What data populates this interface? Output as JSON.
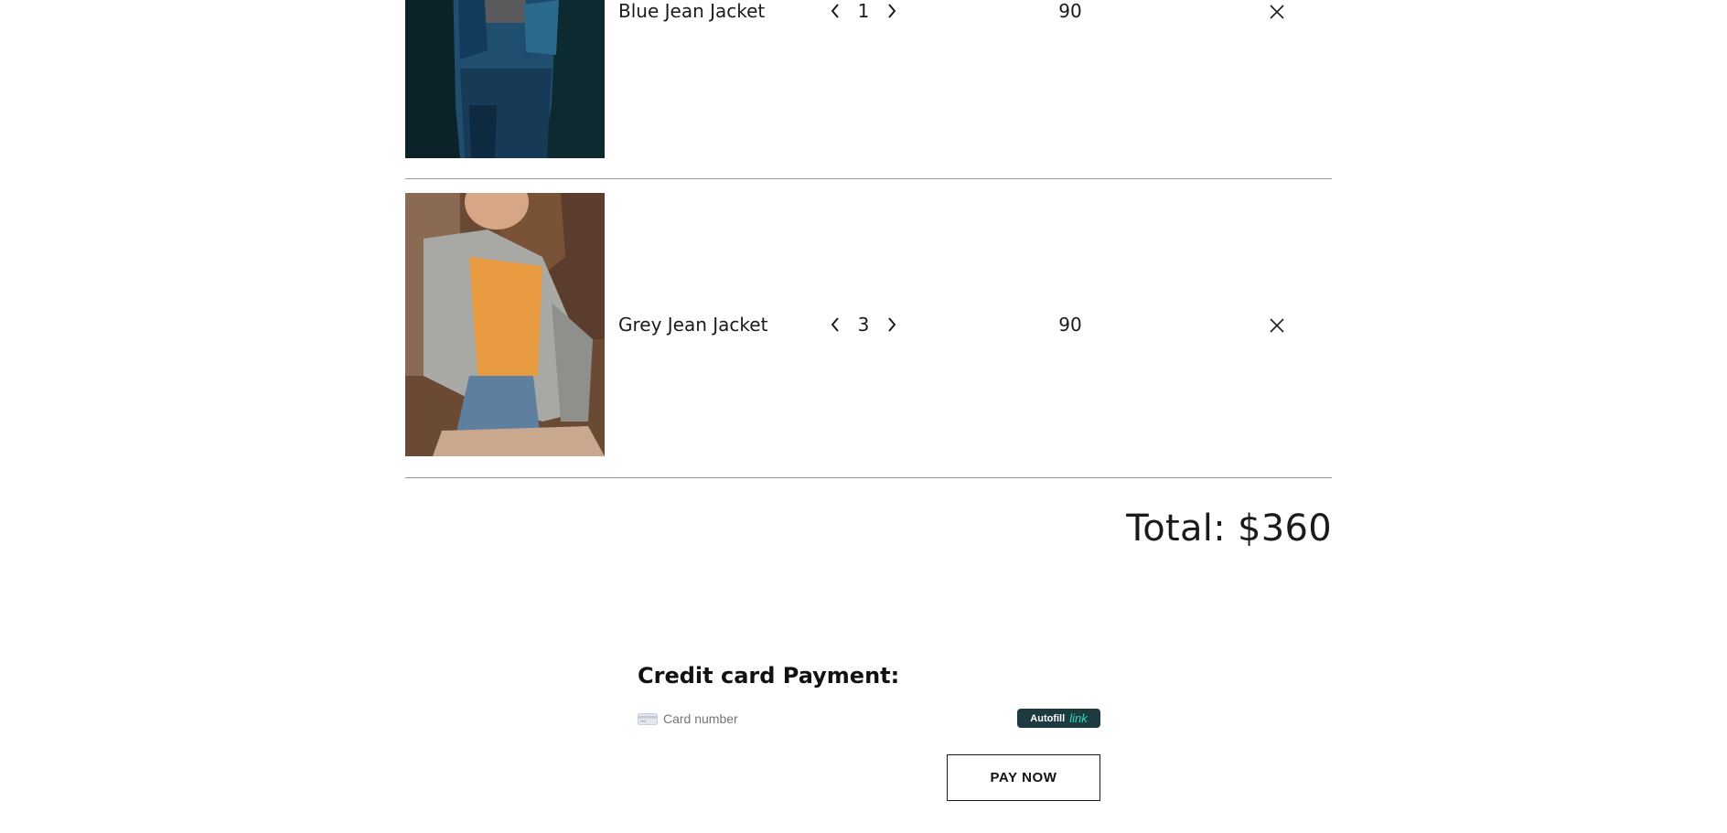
{
  "cart": {
    "items": [
      {
        "name": "Blue Jean Jacket",
        "quantity": "1",
        "price": "90",
        "image_icon": "blue-jean-jacket-photo"
      },
      {
        "name": "Grey Jean Jacket",
        "quantity": "3",
        "price": "90",
        "image_icon": "grey-jean-jacket-photo"
      }
    ],
    "total": "Total: $360"
  },
  "payment": {
    "title": "Credit card Payment:",
    "card_placeholder": "Card number",
    "autofill_label": "Autofill",
    "link_label": "link",
    "pay_button": "PAY NOW"
  },
  "colors": {
    "text": "#1b1b1b",
    "divider": "#9b9b9b",
    "autofill_bg": "#1d3a40",
    "link_accent": "#33ddb3"
  }
}
